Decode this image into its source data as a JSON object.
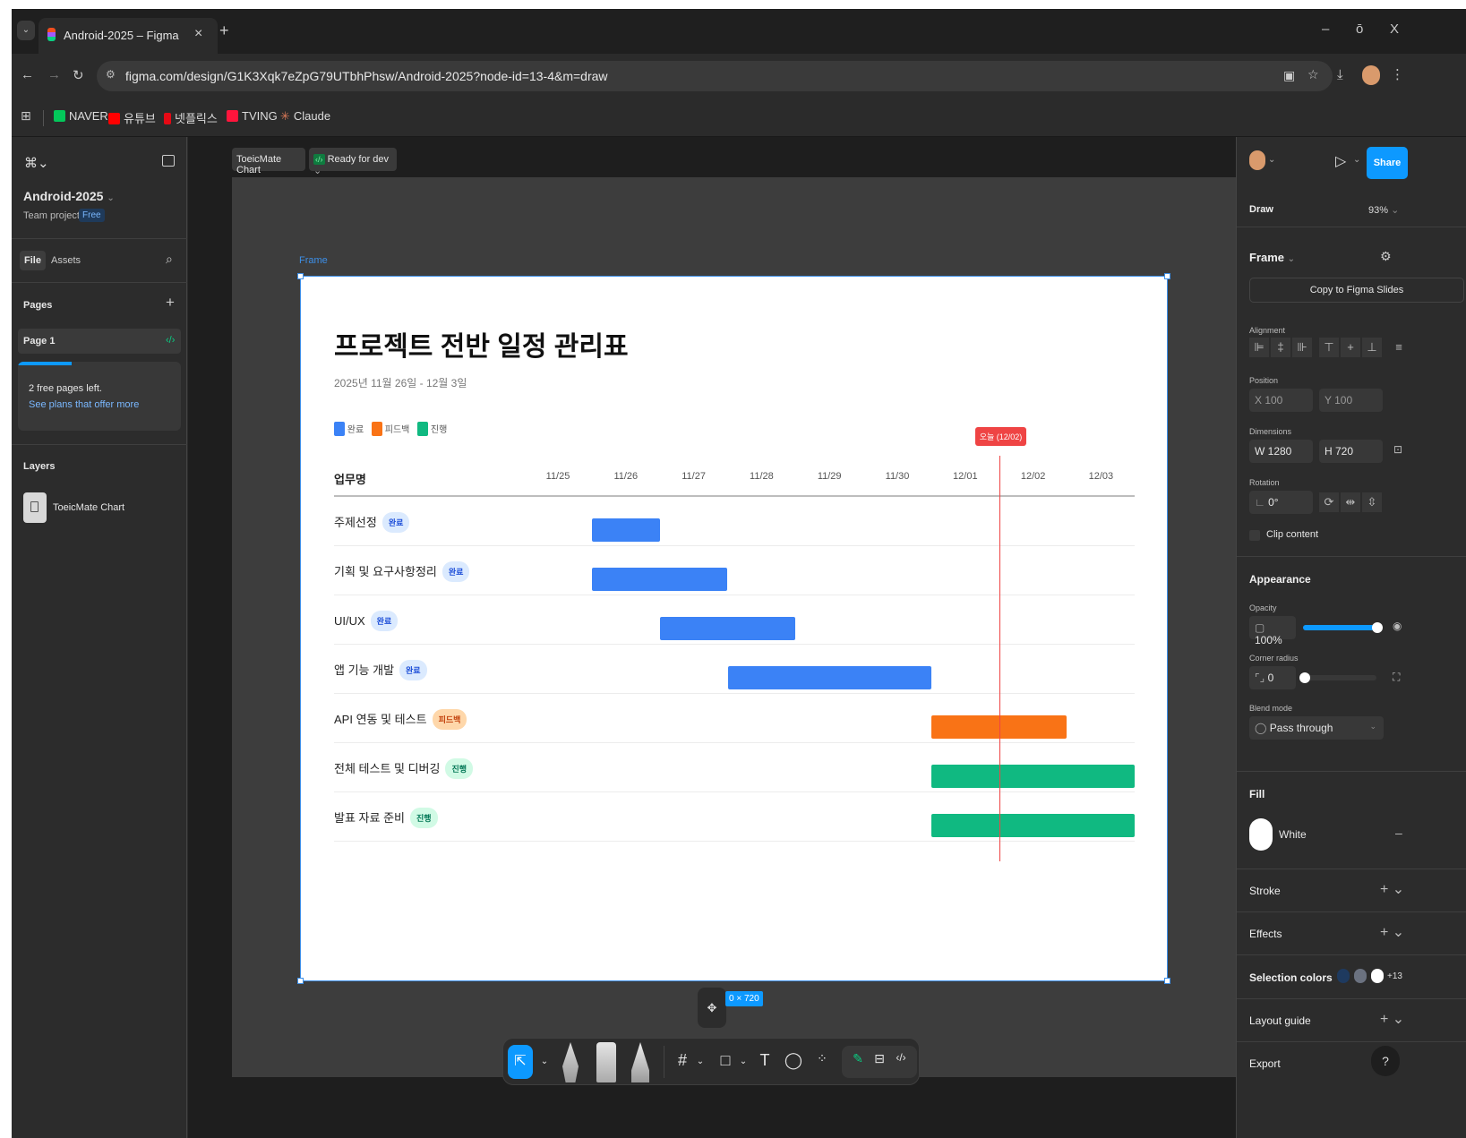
{
  "browser": {
    "tab_title": "Android-2025 – Figma",
    "tab_close": "×",
    "new_tab": "+",
    "url": "figma.com/design/G1K3Xqk7eZpG79UTbhPhsw/Android-2025?node-id=13-4&m=draw",
    "window_controls": [
      "–",
      "ō",
      "X"
    ],
    "bookmarks": [
      {
        "label": "NAVER",
        "color": "#03c75a",
        "glyph": "N"
      },
      {
        "label": "유튜브",
        "color": "#ff0000",
        "glyph": "▶"
      },
      {
        "label": "넷플릭스",
        "color": "#e50914",
        "glyph": ""
      },
      {
        "label": "TVING",
        "color": "#ff153c",
        "glyph": "T"
      },
      {
        "label": "Claude",
        "color": "#d97757",
        "glyph": "✳"
      }
    ]
  },
  "left_panel": {
    "project_name": "Android-2025",
    "project_type": "Team project",
    "plan_badge": "Free",
    "tabs": [
      "File",
      "Assets"
    ],
    "pages_title": "Pages",
    "page_item": "Page 1",
    "upsell_text": "2 free pages left.",
    "upsell_link": "See plans that offer more",
    "layers_title": "Layers",
    "layer_item": "ToeicMate Chart"
  },
  "canvas_header": {
    "breadcrumb": "ToeicMate Chart",
    "status": "Ready for dev"
  },
  "frame": {
    "label": "Frame",
    "size_badge": "0 × 720",
    "title": "프로젝트 전반 일정 관리표",
    "date_range": "2025년 11월 26일 - 12월 3일",
    "legend": [
      {
        "label": "완료",
        "color": "#3b82f6"
      },
      {
        "label": "피드백",
        "color": "#f97316"
      },
      {
        "label": "진행",
        "color": "#10b981"
      }
    ],
    "header_task": "업무명",
    "today_marker": "오늘 (12/02)",
    "today_color": "#ef4444"
  },
  "chart_data": {
    "type": "gantt",
    "dates": [
      "11/25",
      "11/26",
      "11/27",
      "11/28",
      "11/29",
      "11/30",
      "12/01",
      "12/02",
      "12/03"
    ],
    "today_index": 6.5,
    "tasks": [
      {
        "name": "주제선정",
        "status": "완료",
        "start": 0.5,
        "end": 1.5
      },
      {
        "name": "기획 및 요구사항정리",
        "status": "완료",
        "start": 0.5,
        "end": 2.5
      },
      {
        "name": "UI/UX",
        "status": "완료",
        "start": 1.5,
        "end": 3.5
      },
      {
        "name": "앱 기능 개발",
        "status": "완료",
        "start": 2.5,
        "end": 5.5
      },
      {
        "name": "API 연동 및 테스트",
        "status": "피드백",
        "start": 5.5,
        "end": 7.5
      },
      {
        "name": "전체 테스트 및 디버깅",
        "status": "진행",
        "start": 5.5,
        "end": 8.5
      },
      {
        "name": "발표 자료 준비",
        "status": "진행",
        "start": 5.5,
        "end": 8.5
      }
    ],
    "status_colors": {
      "완료": {
        "bar": "#3b82f6",
        "badge_bg": "#dbeafe",
        "badge_fg": "#1d4ed8"
      },
      "피드백": {
        "bar": "#f97316",
        "badge_bg": "#fed7aa",
        "badge_fg": "#c2410c"
      },
      "진행": {
        "bar": "#10b981",
        "badge_bg": "#d1fae5",
        "badge_fg": "#047857"
      }
    }
  },
  "right_panel": {
    "share_label": "Share",
    "mode": "Draw",
    "zoom": "93%",
    "frame_title": "Frame",
    "copy_button": "Copy to Figma Slides",
    "alignment_label": "Alignment",
    "position_label": "Position",
    "x_value": "X  100",
    "y_value": "Y  100",
    "dimensions_label": "Dimensions",
    "w_value": "W  1280",
    "h_value": "H  720",
    "rotation_label": "Rotation",
    "rotation_value": "0°",
    "clip_content": "Clip content",
    "appearance_title": "Appearance",
    "opacity_label": "Opacity",
    "opacity_value": "100%",
    "opacity_level": 1.0,
    "corner_label": "Corner radius",
    "corner_value": "0",
    "blend_label": "Blend mode",
    "blend_value": "Pass through",
    "fill_title": "Fill",
    "fill_value": "White",
    "stroke_title": "Stroke",
    "effects_title": "Effects",
    "selection_colors_title": "Selection colors",
    "selection_more": "+13",
    "layout_guide_title": "Layout guide",
    "export_title": "Export",
    "help": "?"
  }
}
